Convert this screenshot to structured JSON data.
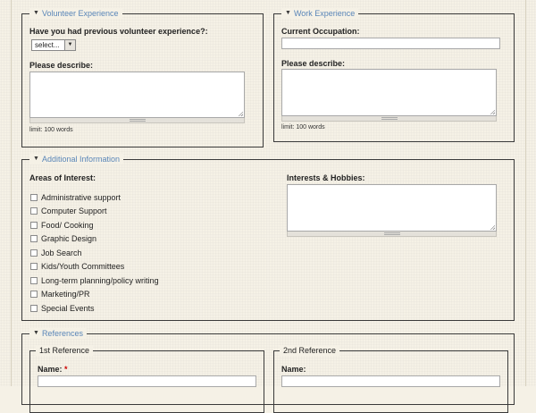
{
  "volunteer": {
    "legend": "Volunteer Experience",
    "question": "Have you had previous volunteer experience?:",
    "select_value": "select...",
    "describe_label": "Please describe:",
    "limit": "limit: 100 words"
  },
  "work": {
    "legend": "Work Experience",
    "occupation_label": "Current Occupation:",
    "describe_label": "Please describe:",
    "limit": "limit: 100 words"
  },
  "additional": {
    "legend": "Additional Information",
    "areas_label": "Areas of Interest:",
    "areas": [
      "Administrative support",
      "Computer Support",
      "Food/ Cooking",
      "Graphic Design",
      "Job Search",
      "Kids/Youth Committees",
      "Long-term planning/policy writing",
      "Marketing/PR",
      "Special Events"
    ],
    "hobbies_label": "Interests & Hobbies:"
  },
  "references": {
    "legend": "References",
    "first": {
      "legend": "1st Reference",
      "name_label": "Name:",
      "required_mark": "*"
    },
    "second": {
      "legend": "2nd Reference",
      "name_label": "Name:"
    }
  },
  "icons": {
    "collapse": "triangle-down-icon",
    "dropdown": "chevron-down-icon",
    "resize": "resize-grip-icon"
  },
  "colors": {
    "legend_text": "#5a86b8",
    "required": "#cc0000",
    "background": "#f5f1e6"
  }
}
